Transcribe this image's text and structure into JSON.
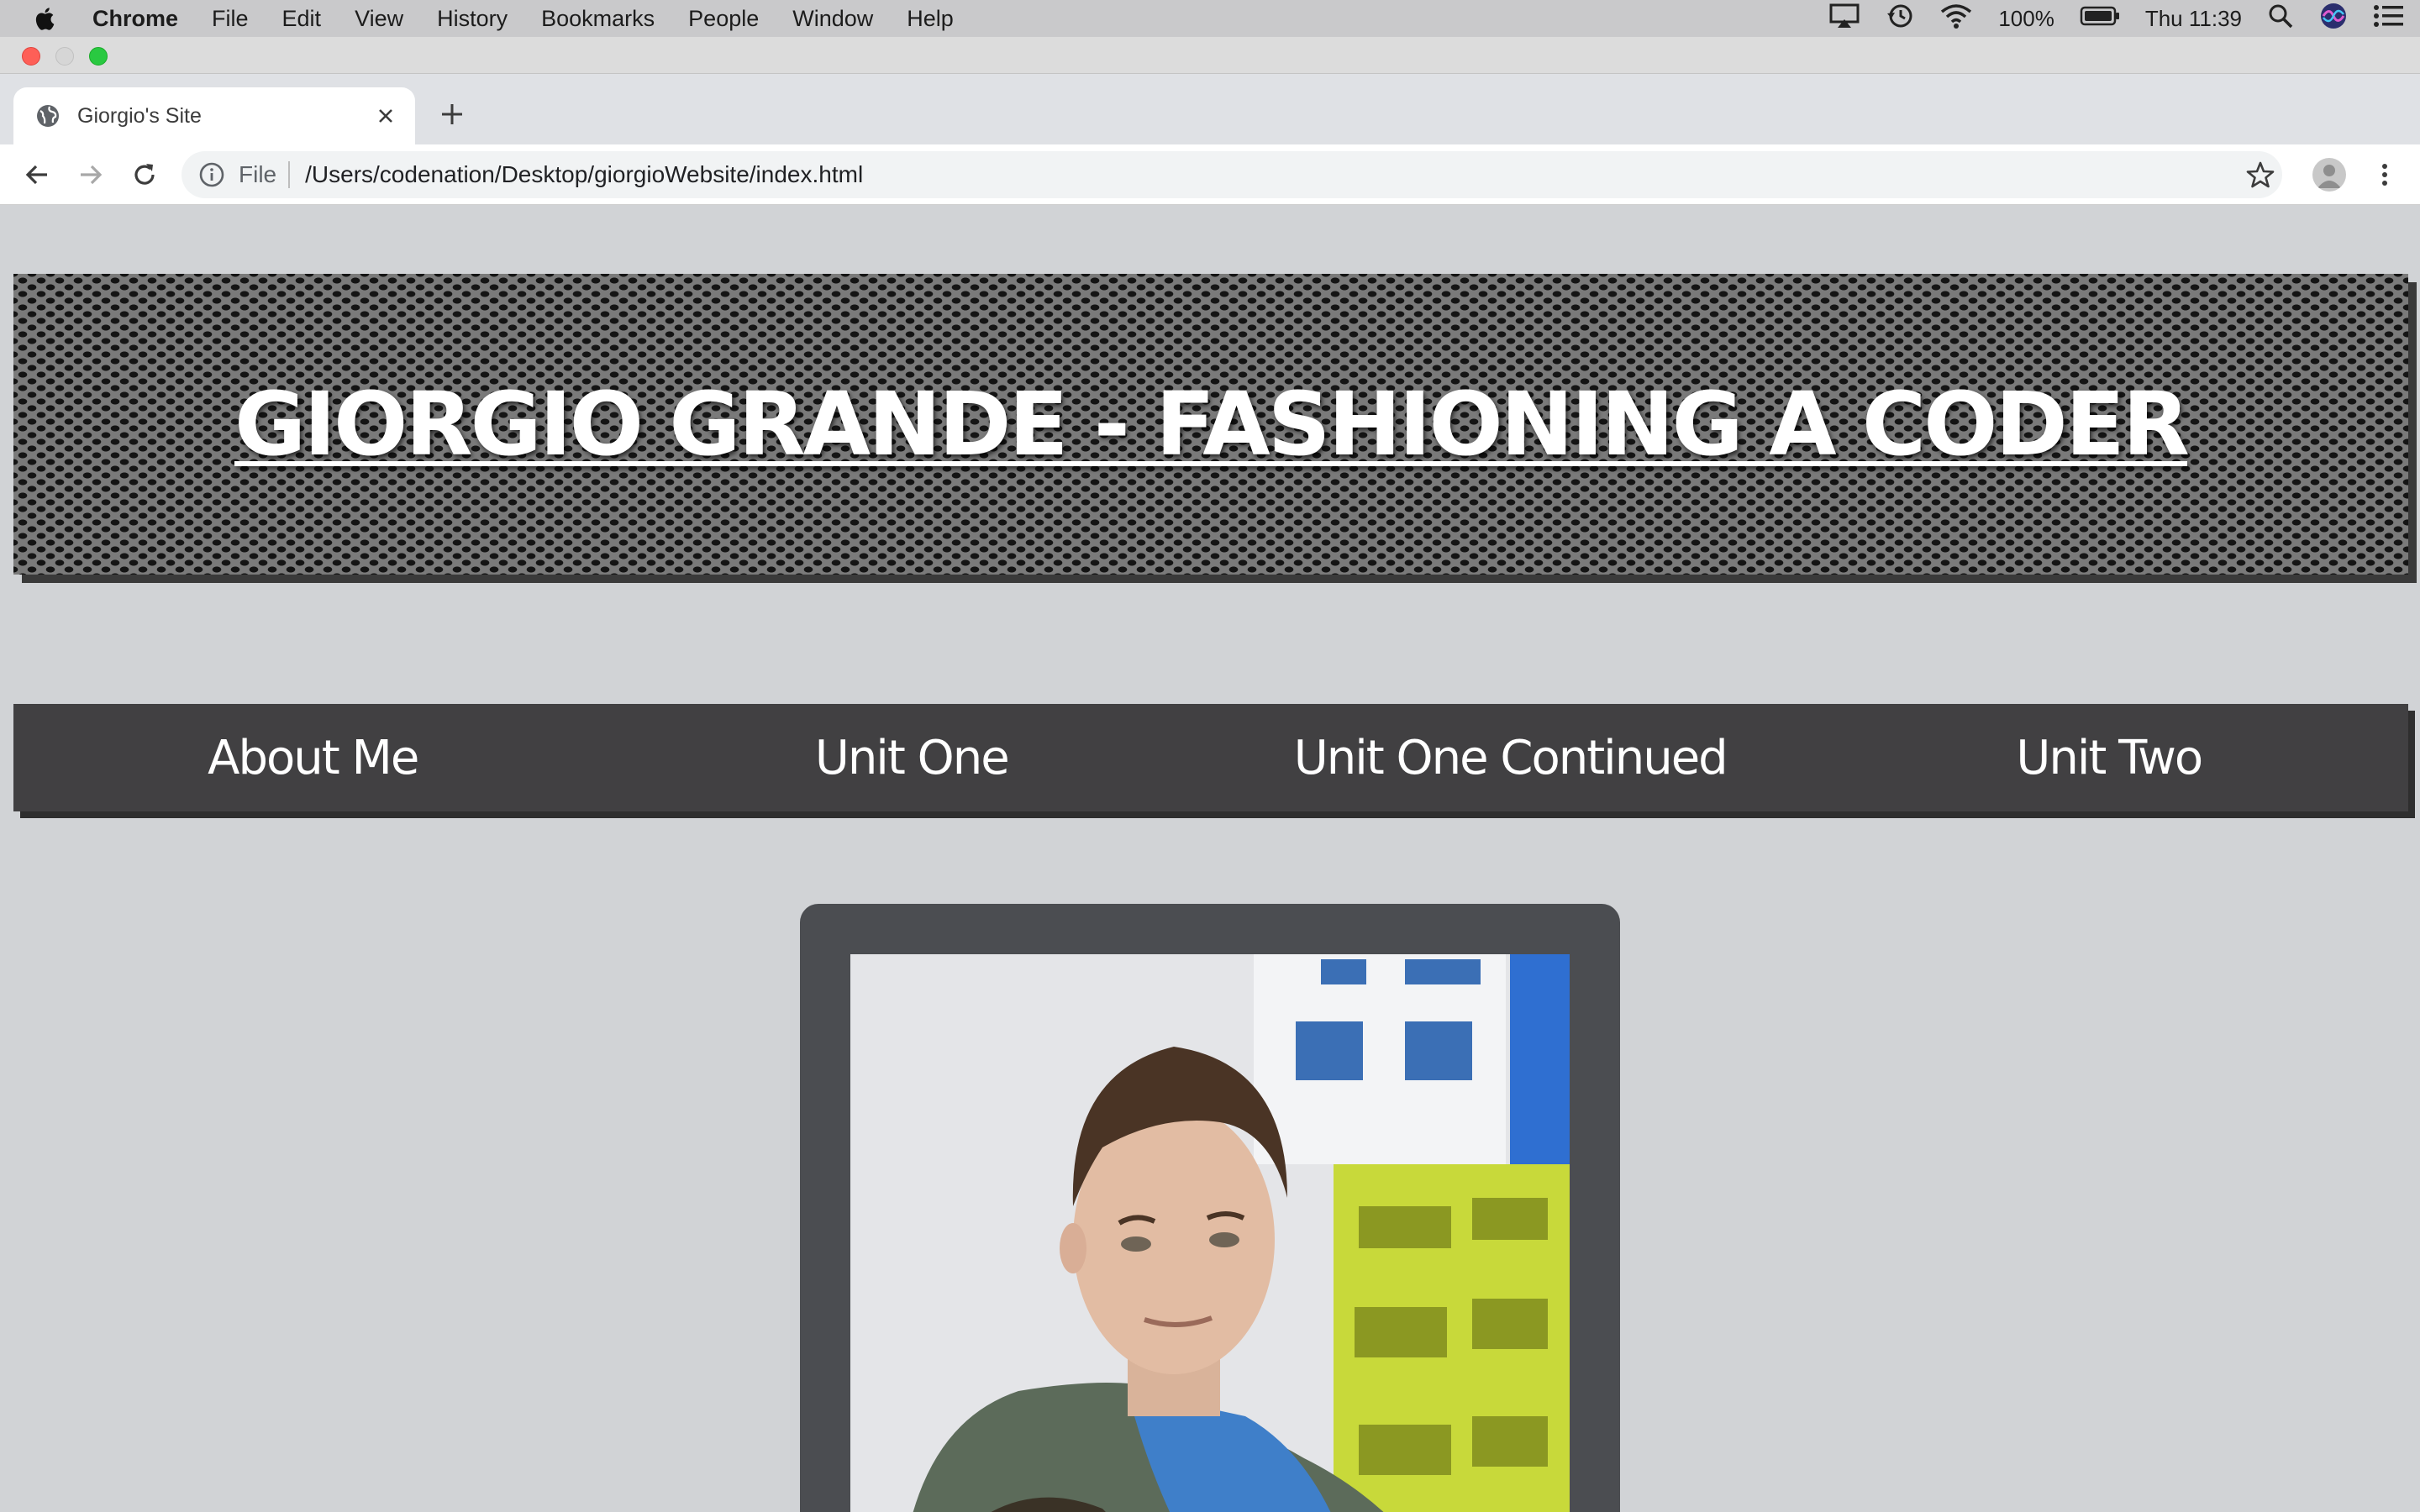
{
  "menubar": {
    "app": "Chrome",
    "items": [
      "File",
      "Edit",
      "View",
      "History",
      "Bookmarks",
      "People",
      "Window",
      "Help"
    ],
    "battery": "100%",
    "clock": "Thu 11:39"
  },
  "tab": {
    "title": "Giorgio's Site"
  },
  "address_bar": {
    "scheme": "File",
    "url": "/Users/codenation/Desktop/giorgioWebsite/index.html"
  },
  "page": {
    "banner_title": "GIORGIO GRANDE - FASHIONING A CODER",
    "nav": [
      "About Me",
      "Unit One",
      "Unit One Continued",
      "Unit Two"
    ]
  },
  "colors": {
    "page_bg": "#d1d3d6",
    "nav_bg": "#414042",
    "frame_bg": "#4b4d51"
  }
}
